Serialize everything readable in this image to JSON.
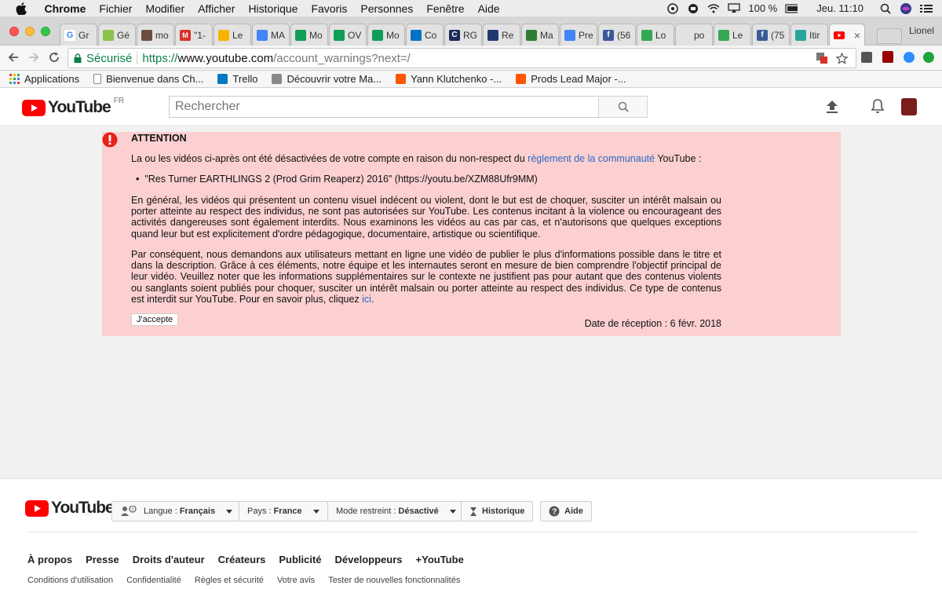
{
  "menubar": {
    "items": [
      "Chrome",
      "Fichier",
      "Modifier",
      "Afficher",
      "Historique",
      "Favoris",
      "Personnes",
      "Fenêtre",
      "Aide"
    ],
    "battery": "100 %",
    "clock": "Jeu. 11:10"
  },
  "tabs": [
    {
      "label": "Gr",
      "icon": "google-icon",
      "color": "#ffffff"
    },
    {
      "label": "Gé",
      "icon": "maps-doc-icon",
      "color": "#8bc34a"
    },
    {
      "label": "mo",
      "icon": "photo-icon",
      "color": "#6d4c41"
    },
    {
      "label": "\"1-",
      "icon": "gmail-icon",
      "color": "#d93025"
    },
    {
      "label": "Le",
      "icon": "drive-icon",
      "color": "#f4b400"
    },
    {
      "label": "MA",
      "icon": "docs-icon",
      "color": "#4285f4"
    },
    {
      "label": "Mo",
      "icon": "drive-icon",
      "color": "#0f9d58"
    },
    {
      "label": "OV",
      "icon": "sheets-icon",
      "color": "#0f9d58"
    },
    {
      "label": "Mo",
      "icon": "sheets-icon",
      "color": "#0f9d58"
    },
    {
      "label": "Co",
      "icon": "outlook-icon",
      "color": "#0072c6"
    },
    {
      "label": "RG",
      "icon": "c-logo-icon",
      "color": "#1a2a5a"
    },
    {
      "label": "Re",
      "icon": "ship-icon",
      "color": "#1e3a6e"
    },
    {
      "label": "Ma",
      "icon": "leaf-icon",
      "color": "#2e7d32"
    },
    {
      "label": "Pre",
      "icon": "docs-icon",
      "color": "#4285f4"
    },
    {
      "label": "(56",
      "icon": "facebook-icon",
      "color": "#3b5998"
    },
    {
      "label": "Lo",
      "icon": "maps-icon",
      "color": "#34a853"
    },
    {
      "label": "po",
      "icon": "blank-icon",
      "color": "#e2e2e2"
    },
    {
      "label": "Le",
      "icon": "maps-icon",
      "color": "#34a853"
    },
    {
      "label": "(75",
      "icon": "facebook-icon",
      "color": "#3b5998"
    },
    {
      "label": "Itir",
      "icon": "pin-icon",
      "color": "#26a69a"
    },
    {
      "label": "",
      "icon": "youtube-icon",
      "color": "#ff0000"
    }
  ],
  "profile": "Lionel",
  "omnibox": {
    "secure_label": "Sécurisé",
    "url_scheme": "https://",
    "url_host": "www.youtube.com",
    "url_path": "/account_warnings?next=/"
  },
  "bookmarks": [
    {
      "label": "Applications",
      "icon": "apps-grid-icon",
      "color": "#ea4335"
    },
    {
      "label": "Bienvenue dans Ch...",
      "icon": "page-icon",
      "color": "#ffffff"
    },
    {
      "label": "Trello",
      "icon": "trello-icon",
      "color": "#0079bf"
    },
    {
      "label": "Découvrir votre Ma...",
      "icon": "apple-icon",
      "color": "#888888"
    },
    {
      "label": "Yann Klutchenko -...",
      "icon": "soundcloud-icon",
      "color": "#ff5500"
    },
    {
      "label": "Prods Lead Major -...",
      "icon": "soundcloud-icon",
      "color": "#ff5500"
    }
  ],
  "youtube": {
    "logo_text": "YouTube",
    "region": "FR",
    "search_placeholder": "Rechercher"
  },
  "warning": {
    "title": "ATTENTION",
    "intro_before": "La ou les vidéos ci-après ont été désactivées de votre compte en raison du non-respect du ",
    "intro_link": "règlement de la communauté",
    "intro_after": " YouTube :",
    "video_item": "\"Res Turner EARTHLINGS 2 (Prod Grim Reaperz) 2016\" (https://youtu.be/XZM88Ufr9MM)",
    "paragraph1": "En général, les vidéos qui présentent un contenu visuel indécent ou violent, dont le but est de choquer, susciter un intérêt malsain ou porter atteinte au respect des individus, ne sont pas autorisées sur YouTube. Les contenus incitant à la violence ou encourageant des activités dangereuses sont également interdits. Nous examinons les vidéos au cas par cas, et n'autorisons que quelques exceptions quand leur but est explicitement d'ordre pédagogique, documentaire, artistique ou scientifique.",
    "paragraph2_before": "Par conséquent, nous demandons aux utilisateurs mettant en ligne une vidéo de publier le plus d'informations possible dans le titre et dans la description. Grâce à ces éléments, notre équipe et les internautes seront en mesure de bien comprendre l'objectif principal de leur vidéo. Veuillez noter que les informations supplémentaires sur le contexte ne justifient pas pour autant que des contenus violents ou sanglants soient publiés pour choquer, susciter un intérêt malsain ou porter atteinte au respect des individus. Ce type de contenus est interdit sur YouTube. Pour en savoir plus, cliquez ",
    "paragraph2_link": "ici",
    "paragraph2_after": ".",
    "accept_label": "J'accepte",
    "received_date": "Date de réception : 6 févr. 2018"
  },
  "footer": {
    "logo_text": "YouTube",
    "language_label": "Langue :",
    "language_value": "Français",
    "country_label": "Pays :",
    "country_value": "France",
    "restricted_label": "Mode restreint :",
    "restricted_value": "Désactivé",
    "history_label": "Historique",
    "help_label": "Aide",
    "links_primary": [
      "À propos",
      "Presse",
      "Droits d'auteur",
      "Créateurs",
      "Publicité",
      "Développeurs",
      "+YouTube"
    ],
    "links_secondary": [
      "Conditions d'utilisation",
      "Confidentialité",
      "Règles et sécurité",
      "Votre avis",
      "Tester de nouvelles fonctionnalités"
    ]
  }
}
